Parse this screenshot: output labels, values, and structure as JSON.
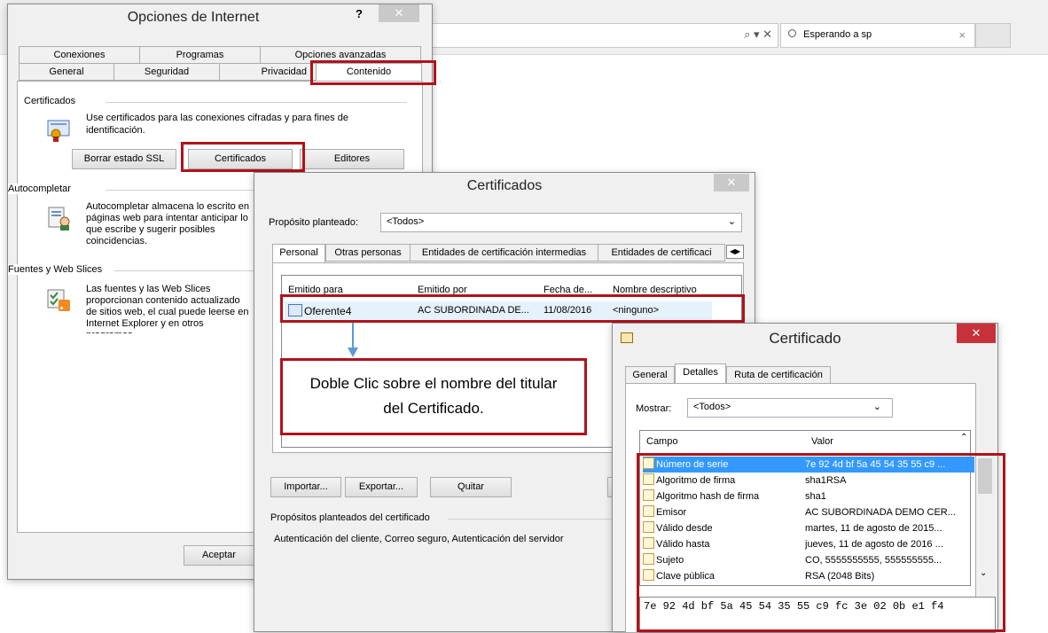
{
  "browser": {
    "tab_label": "Esperando a sp",
    "address_icons": "⌕ ▾ ✕",
    "close_glyph": "×"
  },
  "internet_options": {
    "title": "Opciones de Internet",
    "help": "?",
    "close": "✕",
    "tabs_row1": [
      "Conexiones",
      "Programas",
      "Opciones avanzadas"
    ],
    "tabs_row2": [
      "General",
      "Seguridad",
      "Privacidad",
      "Contenido"
    ],
    "cert_group": "Certificados",
    "cert_desc": "Use certificados para las conexiones cifradas y para fines de identificación.",
    "btn_clear_ssl": "Borrar estado SSL",
    "btn_certs": "Certificados",
    "btn_publishers": "Editores",
    "autocomplete_group": "Autocompletar",
    "autocomplete_desc": "Autocompletar almacena lo escrito en páginas web para intentar anticipar lo que escribe y sugerir posibles coincidencias.",
    "feeds_group": "Fuentes y Web Slices",
    "feeds_desc": "Las fuentes y las Web Slices proporcionan contenido actualizado de sitios web, el cual puede leerse en Internet Explorer y en otros programas.",
    "btn_accept": "Aceptar"
  },
  "certificados": {
    "title": "Certificados",
    "close": "✕",
    "purpose_label": "Propósito planteado:",
    "purpose_value": "<Todos>",
    "tabs": [
      "Personal",
      "Otras personas",
      "Entidades de certificación intermedias",
      "Entidades de certificaci"
    ],
    "columns": [
      "Emitido para",
      "Emitido por",
      "Fecha de...",
      "Nombre descriptivo"
    ],
    "row": {
      "issued_to": "Oferente4",
      "issued_by": "AC SUBORDINADA DE...",
      "date": "11/08/2016",
      "friendly": "<ninguno>"
    },
    "callout": "Doble Clic sobre el nombre del titular del Certificado.",
    "btn_import": "Importar...",
    "btn_export": "Exportar...",
    "btn_remove": "Quitar",
    "purposes_group": "Propósitos planteados del certificado",
    "purposes_text": "Autenticación del cliente, Correo seguro, Autenticación del servidor"
  },
  "certificado": {
    "title": "Certificado",
    "close": "✕",
    "tabs": [
      "General",
      "Detalles",
      "Ruta de certificación"
    ],
    "show_label": "Mostrar:",
    "show_value": "<Todos>",
    "columns": [
      "Campo",
      "Valor"
    ],
    "fields": [
      {
        "campo": "Número de serie",
        "valor": "7e 92 4d bf 5a 45 54 35 55 c9 ..."
      },
      {
        "campo": "Algoritmo de firma",
        "valor": "sha1RSA"
      },
      {
        "campo": "Algoritmo hash de firma",
        "valor": "sha1"
      },
      {
        "campo": "Emisor",
        "valor": "AC SUBORDINADA DEMO CER..."
      },
      {
        "campo": "Válido desde",
        "valor": "martes, 11 de agosto de 2015..."
      },
      {
        "campo": "Válido hasta",
        "valor": "jueves, 11 de agosto de 2016 ..."
      },
      {
        "campo": "Sujeto",
        "valor": "CO, 5555555555, 555555555..."
      },
      {
        "campo": "Clave pública",
        "valor": "RSA (2048 Bits)"
      }
    ],
    "detail_value": "7e 92 4d bf 5a 45 54 35 55 c9 fc 3e 02 0b e1 f4"
  },
  "colors": {
    "accent_red": "#b0131b",
    "select_blue": "#3399ff",
    "close_red": "#c7323a"
  }
}
